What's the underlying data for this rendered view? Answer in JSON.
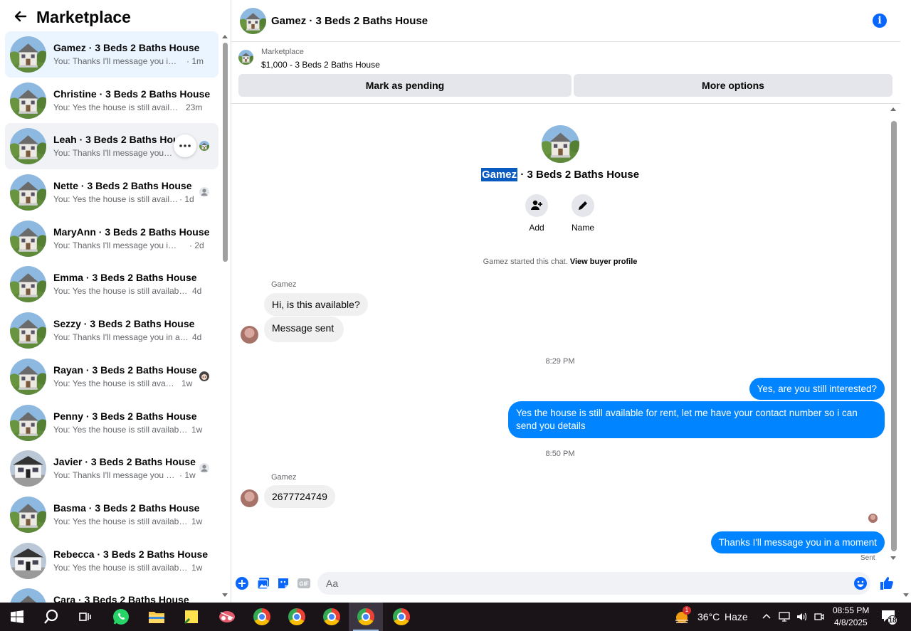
{
  "sidebar": {
    "title": "Marketplace",
    "conversations": [
      {
        "name": "Gamez · 3 Beds 2 Baths House",
        "preview": "You: Thanks I'll message you in a ...",
        "time": "· 1m",
        "state": "active",
        "seen": "none"
      },
      {
        "name": "Christine · 3 Beds 2 Baths House",
        "preview": "You: Yes the house is still availabl...",
        "time": "23m",
        "state": "normal",
        "seen": "none"
      },
      {
        "name": "Leah · 3 Beds 2 Baths House",
        "preview": "You: Thanks I'll message you in...",
        "time": "",
        "state": "hover",
        "seen": "house"
      },
      {
        "name": "Nette · 3 Beds 2 Baths House",
        "preview": "You: Yes the house is still availab...",
        "time": "· 1d",
        "state": "normal",
        "seen": "person"
      },
      {
        "name": "MaryAnn · 3 Beds 2 Baths House",
        "preview": "You: Thanks I'll message you in a ...",
        "time": "· 2d",
        "state": "normal",
        "seen": "none"
      },
      {
        "name": "Emma · 3 Beds 2 Baths House",
        "preview": "You: Yes the house is still available ...",
        "time": "4d",
        "state": "normal",
        "seen": "none"
      },
      {
        "name": "Sezzy · 3 Beds 2 Baths House",
        "preview": "You: Thanks I'll message you in a ...",
        "time": "4d",
        "state": "normal",
        "seen": "none"
      },
      {
        "name": "Rayan · 3 Beds 2 Baths House",
        "preview": "You: Yes the house is still availa...",
        "time": "1w",
        "state": "normal",
        "seen": "face"
      },
      {
        "name": "Penny · 3 Beds 2 Baths House",
        "preview": "You: Yes the house is still available ...",
        "time": "1w",
        "state": "normal",
        "seen": "none"
      },
      {
        "name": "Javier · 3 Beds 2 Baths House",
        "preview": "You: Thanks I'll message you in ...",
        "time": "· 1w",
        "state": "normal",
        "seen": "person"
      },
      {
        "name": "Basma · 3 Beds 2 Baths House",
        "preview": "You: Yes the house is still available ...",
        "time": "1w",
        "state": "normal",
        "seen": "none"
      },
      {
        "name": "Rebecca · 3 Beds 2 Baths House",
        "preview": "You: Yes the house is still available ...",
        "time": "1w",
        "state": "normal",
        "seen": "none"
      },
      {
        "name": "Cara · 3 Beds 2 Baths House",
        "preview": "",
        "time": "",
        "state": "normal",
        "seen": "none"
      }
    ]
  },
  "chat": {
    "header_title": "Gamez · 3 Beds 2 Baths House",
    "listing": {
      "source": "Marketplace",
      "price_title": "$1,000 - 3 Beds 2 Baths House",
      "mark_pending_label": "Mark as pending",
      "more_options_label": "More options"
    },
    "title_highlight": "Gamez",
    "title_rest": " · 3 Beds 2 Baths House",
    "actions": {
      "add_label": "Add",
      "name_label": "Name"
    },
    "started_text": "Gamez started this chat.",
    "view_profile_label": "View buyer profile",
    "sender_1": "Gamez",
    "msg_in_1": "Hi, is this available?",
    "msg_in_2": "Message sent",
    "time_1": "8:29 PM",
    "msg_out_1": "Yes, are you still interested?",
    "msg_out_2": "Yes the house is still available for rent, let me have your contact number so i can send you details",
    "time_2": "8:50 PM",
    "sender_2": "Gamez",
    "msg_in_3": "2677724749",
    "msg_out_3": "Thanks I'll message you in a moment",
    "sent_label": "Sent",
    "composer_placeholder": "Aa"
  },
  "taskbar": {
    "weather_temp": "36°C",
    "weather_desc": "Haze",
    "weather_badge": "1",
    "time": "08:55 PM",
    "date": "4/8/2025",
    "notif_count": "18"
  },
  "colors": {
    "accent": "#0866ff",
    "bubble_out": "#0084ff",
    "bubble_in": "#f0f0f0"
  }
}
